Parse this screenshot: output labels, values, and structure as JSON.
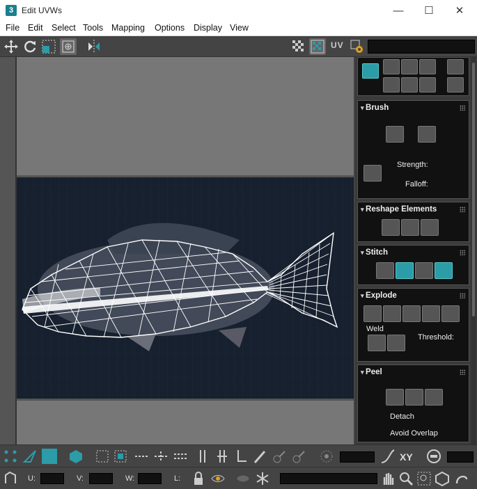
{
  "window": {
    "title": "Edit UVWs",
    "app_icon_text": "3",
    "minimize": "—",
    "maximize": "☐",
    "close": "✕"
  },
  "menu": [
    "File",
    "Edit",
    "Select",
    "Tools",
    "Mapping",
    "Options",
    "Display",
    "View"
  ],
  "toolbar": {
    "uv_label": "UV"
  },
  "panels": {
    "brush": {
      "title": "Brush",
      "strength_label": "Strength:",
      "falloff_label": "Falloff:"
    },
    "reshape": {
      "title": "Reshape Elements"
    },
    "stitch": {
      "title": "Stitch"
    },
    "explode": {
      "title": "Explode",
      "weld_label": "Weld",
      "threshold_label": "Threshold:"
    },
    "peel": {
      "title": "Peel",
      "detach_label": "Detach",
      "avoid_overlap_label": "Avoid Overlap"
    }
  },
  "bottom": {
    "xy_label": "XY",
    "u_label": "U:",
    "v_label": "V:",
    "w_label": "W:",
    "l_label": "L:"
  }
}
